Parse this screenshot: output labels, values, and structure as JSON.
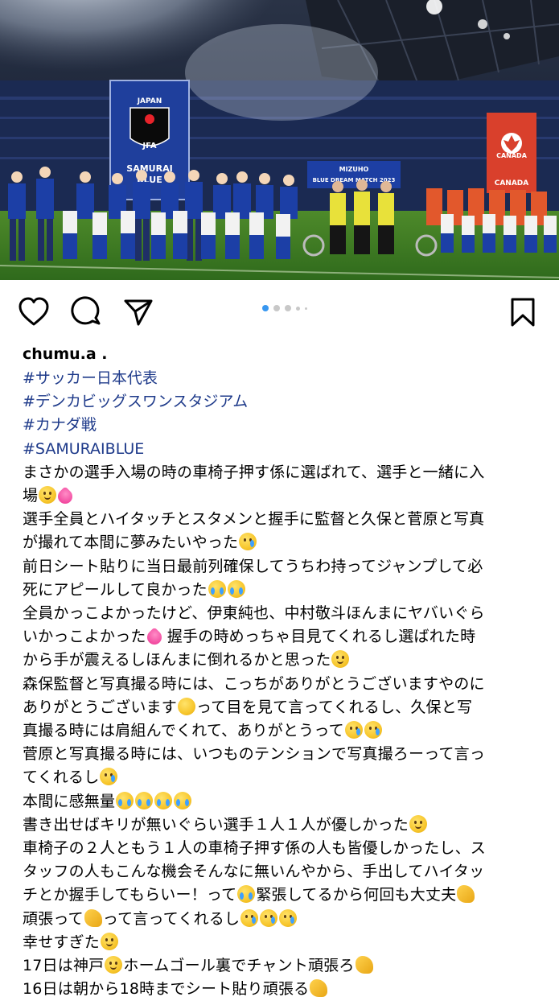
{
  "post": {
    "photo_alt": "Stadium line-up photo",
    "banners": {
      "left_top": "JAPAN",
      "left_logo": "JFA",
      "left_bottom_1": "SAMURAI",
      "left_bottom_2": "BLUE",
      "center_1": "MIZUHO",
      "center_2": "BLUE DREAM MATCH 2023",
      "right_top": "CANADA",
      "right_bottom": "CANADA"
    },
    "carousel": {
      "count": 5,
      "active_index": 0
    }
  },
  "icons": {
    "like": "heart-icon",
    "comment": "comment-icon",
    "share": "send-icon",
    "save": "bookmark-icon"
  },
  "colors": {
    "hashtag": "#1e3a8a",
    "dot_active": "#3897f0",
    "dot_inactive": "#c8c8c8"
  },
  "caption": {
    "username": "chumu.a .",
    "hashtags": [
      "#サッカー日本代表",
      "#デンカビッグスワンスタジアム",
      "#カナダ戦",
      "#SAMURAIBLUE"
    ],
    "lines": [
      "まさかの選手入場の時の車椅子押す係に選ばれて、選手と一緒に入",
      "場",
      "選手全員とハイタッチとスタメンと握手に監督と久保と菅原と写真",
      "が撮れて本間に夢みたいやった",
      "前日シート貼りに当日最前列確保してうちわ持ってジャンプして必",
      "死にアピールして良かった",
      "全員かっこよかったけど、伊東純也、中村敬斗ほんまにヤバいぐら",
      "いかっこよかった",
      "握手の時めっちゃ目見てくれるし選ばれた時",
      "から手が震えるしほんまに倒れるかと思った",
      "森保監督と写真撮る時には、こっちがありがとうございますやのに",
      "ありがとうございます",
      "って目を見て言ってくれるし、久保と写",
      "真撮る時には肩組んでくれて、ありがとうって",
      "菅原と写真撮る時には、いつものテンションで写真撮ろーって言っ",
      "てくれるし",
      "本間に感無量",
      "書き出せばキリが無いぐらい選手１人１人が優しかった",
      "車椅子の２人ともう１人の車椅子押す係の人も皆優しかったし、ス",
      "タッフの人もこんな機会そんなに無いんやから、手出してハイタッ",
      "チとか握手してもらいー！って",
      "緊張してるから何回も大丈夫",
      "頑張って",
      "って言ってくれるし",
      "幸せすぎた",
      "17日は神戸",
      "ホームゴール裏でチャント頑張ろ",
      "16日は朝から18時までシート貼り頑張る"
    ]
  }
}
